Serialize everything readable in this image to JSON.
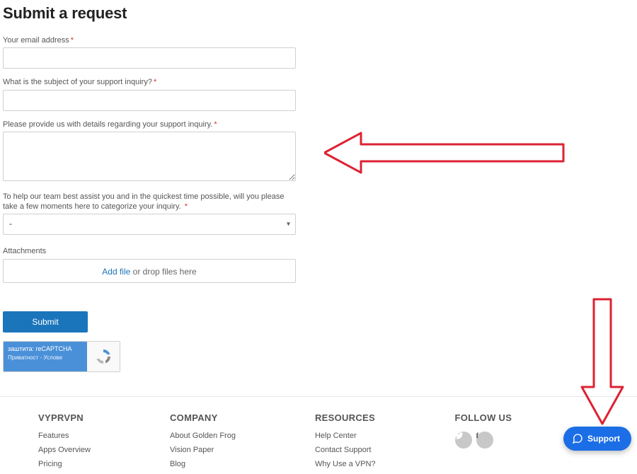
{
  "title": "Submit a request",
  "form": {
    "email_label": "Your email address",
    "subject_label": "What is the subject of your support inquiry?",
    "details_label": "Please provide us with details regarding your support inquiry.",
    "category_label": "To help our team best assist you and in the quickest time possible, will you please take a few moments here to categorize your inquiry.",
    "category_value": "-",
    "attachments_label": "Attachments",
    "add_file": "Add file",
    "drop_hint": " or drop files here",
    "submit": "Submit"
  },
  "recaptcha": {
    "line1": "заштита: reCAPTCHA",
    "line2": "Приватност - Услови"
  },
  "footer": {
    "col1": {
      "title": "VYPRVPN",
      "links": [
        "Features",
        "Apps Overview",
        "Pricing"
      ]
    },
    "col2": {
      "title": "COMPANY",
      "links": [
        "About Golden Frog",
        "Vision Paper",
        "Blog"
      ]
    },
    "col3": {
      "title": "RESOURCES",
      "links": [
        "Help Center",
        "Contact Support",
        "Why Use a VPN?"
      ]
    },
    "col4": {
      "title": "FOLLOW US"
    }
  },
  "support_bubble": "Support"
}
